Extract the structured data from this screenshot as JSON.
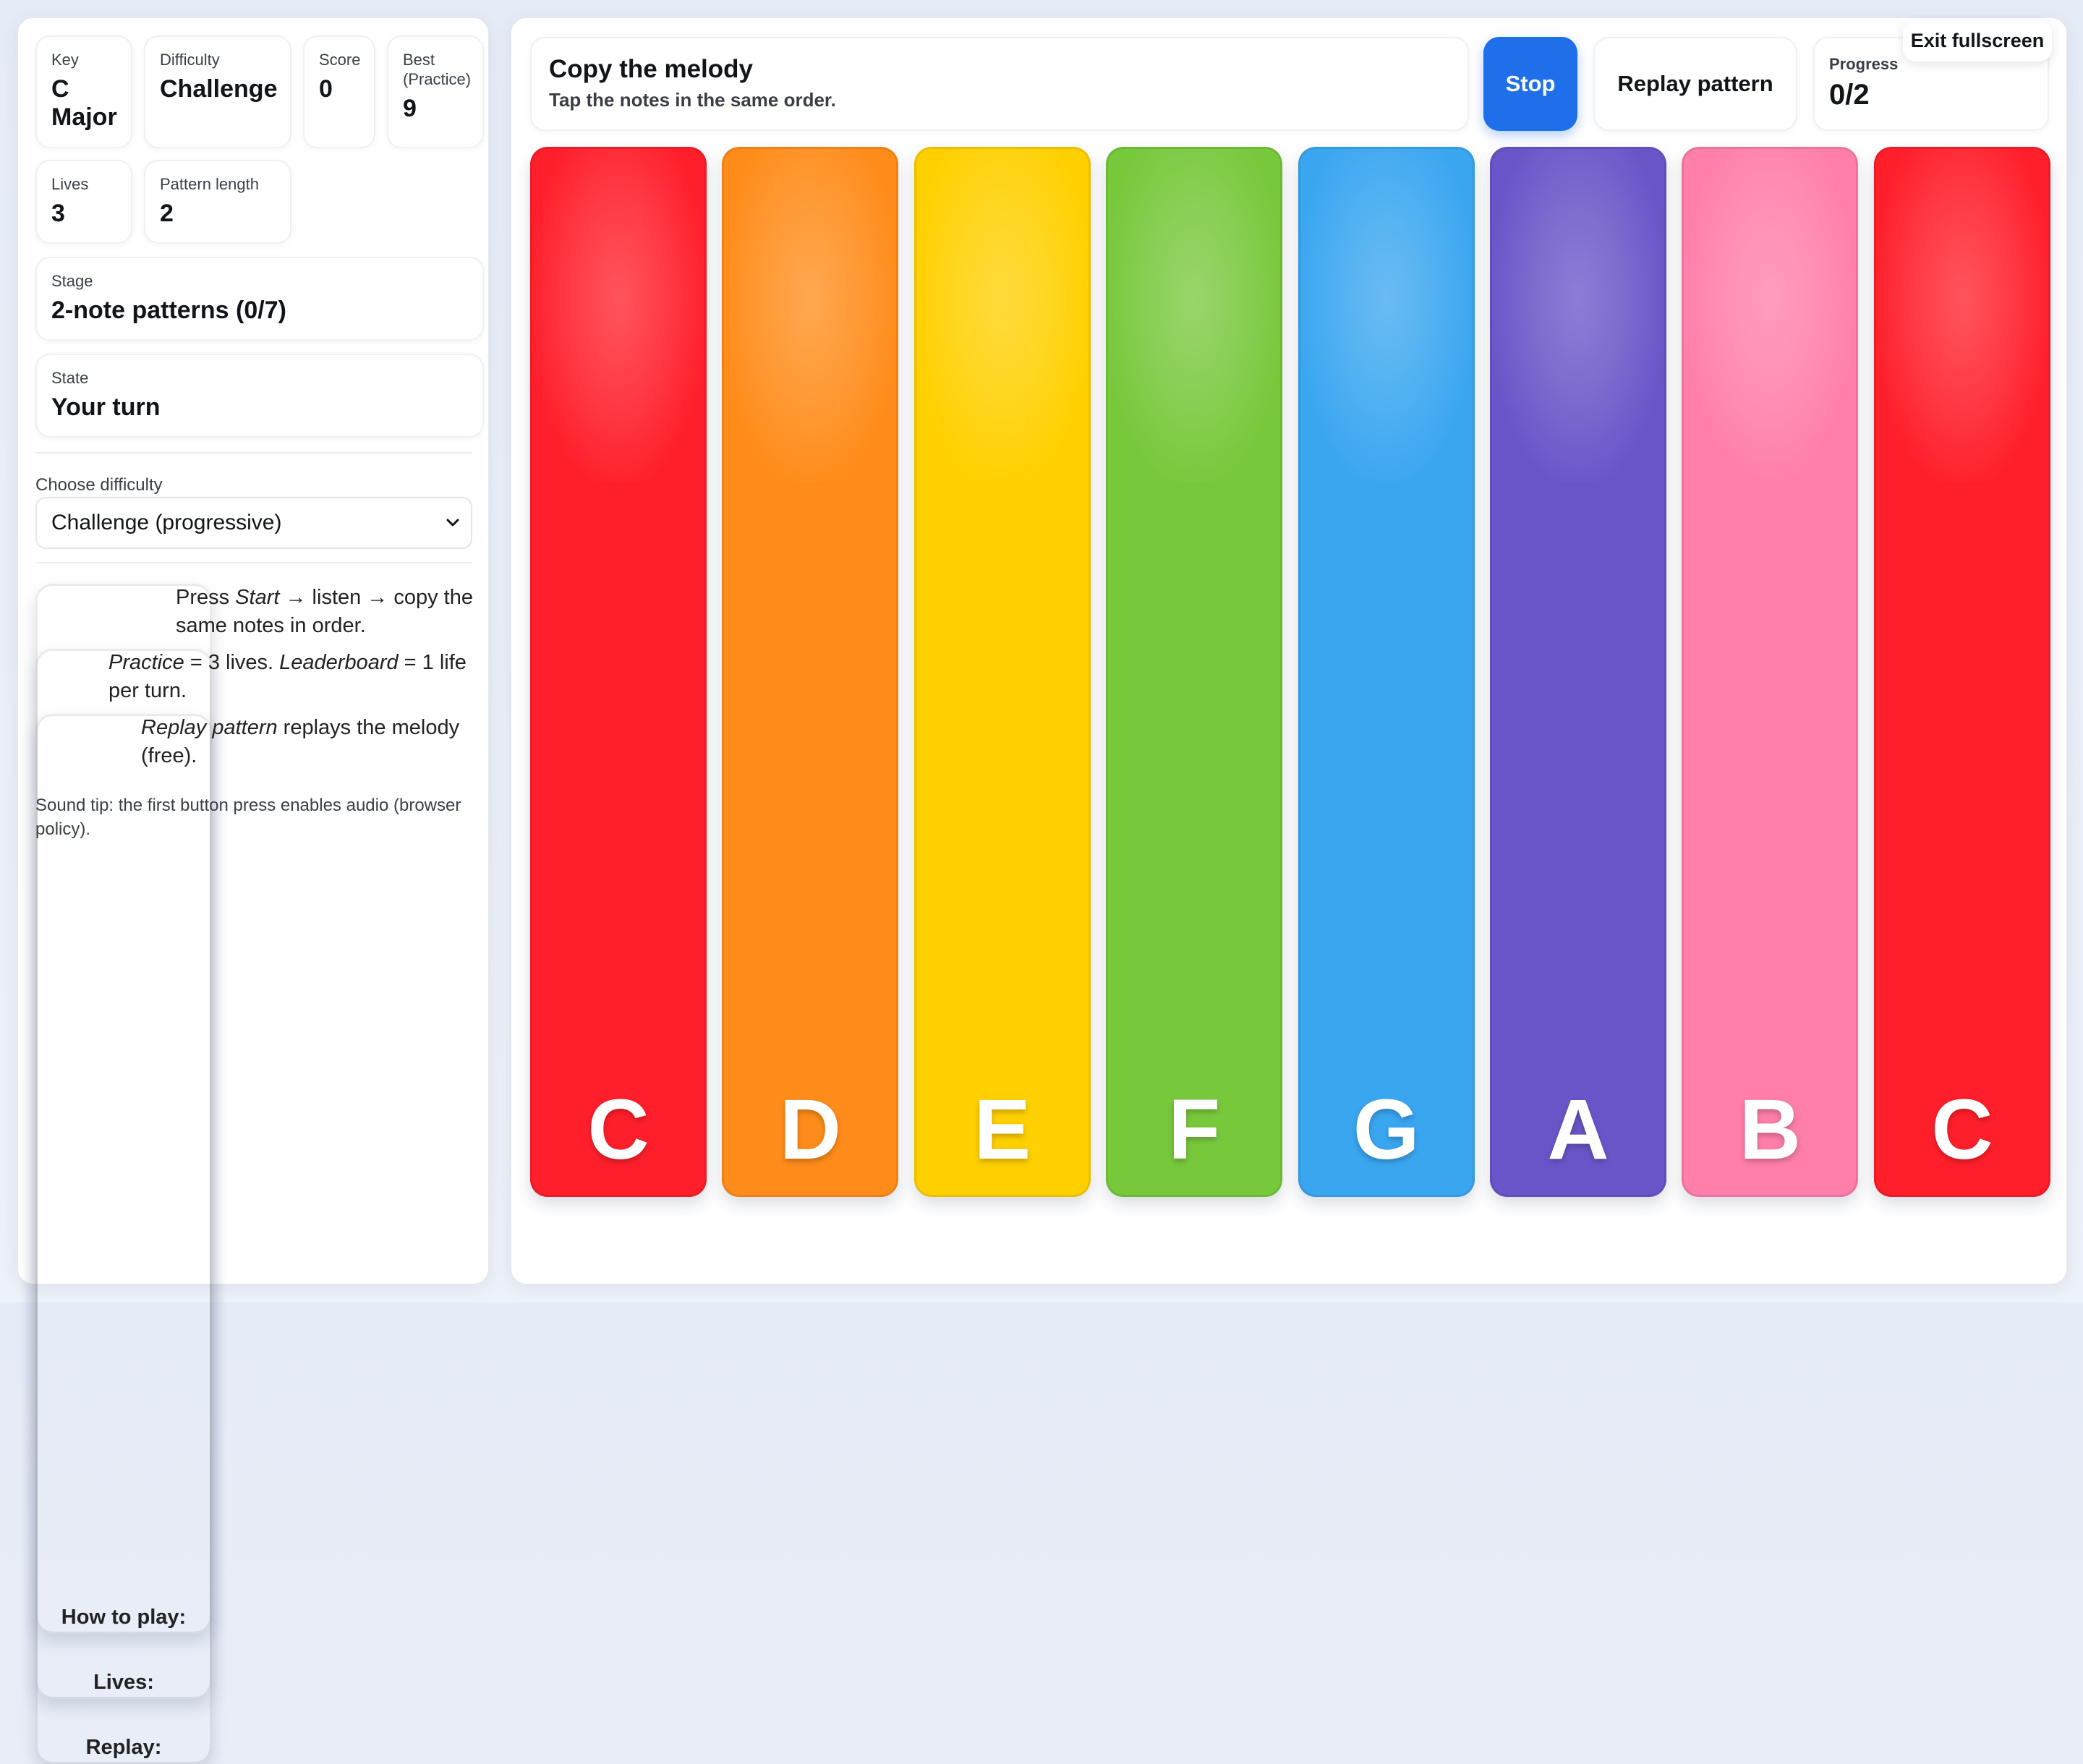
{
  "stats": {
    "key": {
      "label": "Key",
      "value": "C Major"
    },
    "difficulty": {
      "label": "Difficulty",
      "value": "Challenge"
    },
    "score": {
      "label": "Score",
      "value": "0"
    },
    "best": {
      "label": "Best (Practice)",
      "value": "9"
    },
    "lives": {
      "label": "Lives",
      "value": "3"
    },
    "pattern_length": {
      "label": "Pattern length",
      "value": "2"
    },
    "stage": {
      "label": "Stage",
      "value": "2-note patterns (0/7)"
    },
    "state": {
      "label": "State",
      "value": "Your turn"
    }
  },
  "difficulty_select": {
    "label": "Choose difficulty",
    "selected": "Challenge (progressive)"
  },
  "help": {
    "how_key": "How to play:",
    "how_pre": "Press ",
    "how_em": "Start",
    "how_post": " → listen → copy the same notes in order.",
    "lives_key": "Lives:",
    "lives_em1": "Practice",
    "lives_mid": " = 3 lives. ",
    "lives_em2": "Leaderboard",
    "lives_post": " = 1 life per turn.",
    "replay_key": "Replay:",
    "replay_em": "Replay pattern",
    "replay_post": " replays the melody (free).",
    "tip": "Sound tip: the first button press enables audio (browser policy)."
  },
  "prompt": {
    "title": "Copy the melody",
    "subtitle": "Tap the notes in the same order."
  },
  "buttons": {
    "stop": "Stop",
    "replay": "Replay pattern",
    "exit_fullscreen": "Exit fullscreen"
  },
  "progress": {
    "label": "Progress",
    "value": "0/2"
  },
  "keys": [
    {
      "note": "C",
      "color": "#ff1f2b"
    },
    {
      "note": "D",
      "color": "#ff8c1a"
    },
    {
      "note": "E",
      "color": "#ffd000"
    },
    {
      "note": "F",
      "color": "#78c83c"
    },
    {
      "note": "G",
      "color": "#3aa6f0"
    },
    {
      "note": "A",
      "color": "#6a55c8"
    },
    {
      "note": "B",
      "color": "#ff7eaa"
    },
    {
      "note": "C",
      "color": "#ff1f2b"
    }
  ]
}
